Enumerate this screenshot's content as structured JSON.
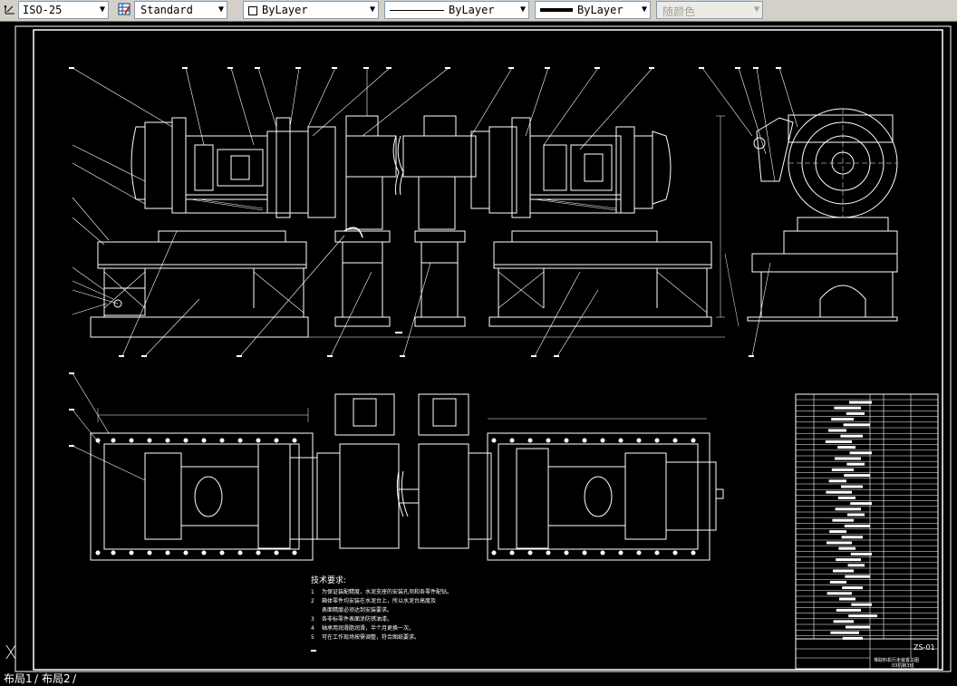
{
  "toolbar": {
    "dimstyle": {
      "value": "ISO-25"
    },
    "tablestyle": {
      "value": "Standard"
    },
    "layer_color": {
      "value": "ByLayer"
    },
    "linetype": {
      "value": "ByLayer"
    },
    "lineweight": {
      "value": "ByLayer"
    },
    "plotstyle": {
      "value": "随颜色"
    }
  },
  "drawing": {
    "tech_title": "技术要求:",
    "tech_notes": [
      {
        "num": "1",
        "text": "为保证装配精度，水泥支座的安装孔须和各零件配钻。"
      },
      {
        "num": "2",
        "text": "箱体零件均安装在水泥台上，所以水泥台高度及"
      },
      {
        "num": "",
        "text": "表面精度必须达到安装要求。"
      },
      {
        "num": "3",
        "text": "各非标零件表面涂防锈油漆。"
      },
      {
        "num": "4",
        "text": "轴承用润滑脂润滑，半个月更换一次。"
      },
      {
        "num": "5",
        "text": "可在工作现场按需调整，符合图纸要求。"
      }
    ],
    "title_block": {
      "drawing_no": "ZS-01",
      "name": "堆取料机行走装置总图",
      "scale": "03机制3班"
    }
  },
  "layout_tabs": [
    "布局1",
    "布局2"
  ],
  "colors": {
    "background": "#000000",
    "lines": "#ffffff",
    "toolbar": "#d4d0c8"
  }
}
